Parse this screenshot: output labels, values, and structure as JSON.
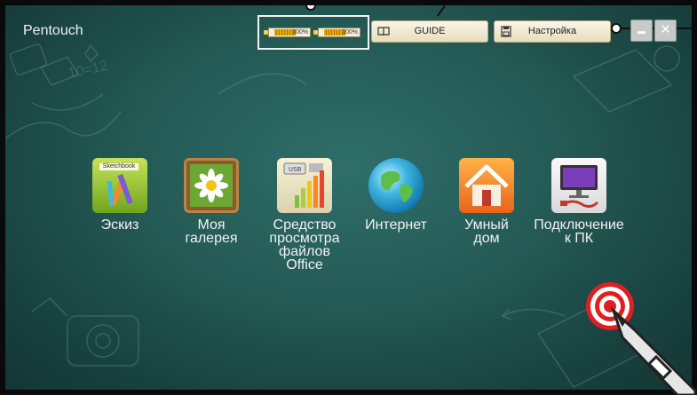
{
  "app_title": "Pentouch",
  "header": {
    "batteries": [
      {
        "percent_label": "100%",
        "level": 1.0
      },
      {
        "percent_label": "100%",
        "level": 1.0
      }
    ],
    "guide_button": {
      "label": "GUIDE",
      "icon": "book-icon"
    },
    "settings_button": {
      "label": "Настройка",
      "icon": "save-icon"
    },
    "window_buttons": [
      {
        "icon": "minimize-icon",
        "glyph": "▬"
      },
      {
        "icon": "close-icon",
        "glyph": "✕"
      }
    ]
  },
  "apps": [
    {
      "id": "sketch",
      "label": "Эскиз",
      "icon": "sketchbook-icon",
      "icon_text": "Sketchbook"
    },
    {
      "id": "gallery",
      "label": "Моя\nгалерея",
      "icon": "gallery-icon"
    },
    {
      "id": "office",
      "label": "Средство\nпросмотра\nфайлов\nOffice",
      "icon": "office-viewer-icon"
    },
    {
      "id": "internet",
      "label": "Интернет",
      "icon": "globe-icon"
    },
    {
      "id": "home",
      "label": "Умный\nдом",
      "icon": "house-icon"
    },
    {
      "id": "pc",
      "label": "Подключение\nк ПК",
      "icon": "monitor-icon"
    }
  ],
  "colors": {
    "board": "#245954",
    "frame": "#0a0a0a",
    "button_bg": "#f4eeda",
    "text": "#f2f2f2"
  },
  "overlay_icons": [
    "touch-target-icon",
    "pen-icon"
  ]
}
